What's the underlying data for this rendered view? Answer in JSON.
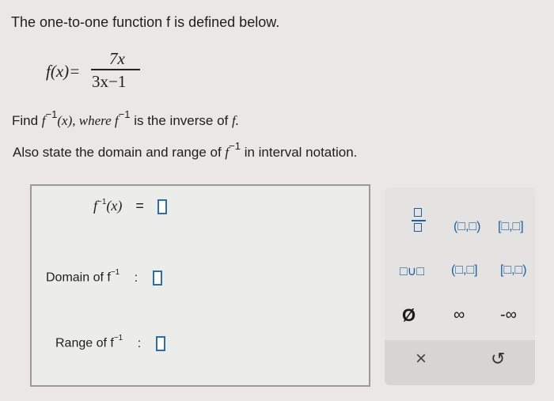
{
  "question": {
    "line1": "The one-to-one function f is defined below.",
    "func_lhs": "f(x)=",
    "numerator": "7x",
    "denominator": "3x−1",
    "find_prefix": "Find ",
    "find_f": "f",
    "exp": "−1",
    "find_mid": "(x), where ",
    "find_suffix": " is the inverse of ",
    "find_end": "f.",
    "also_prefix": "Also state the domain and range of ",
    "also_suffix": " in interval notation."
  },
  "answers": {
    "f_inv_label": "f",
    "f_inv_exp": "−1",
    "f_inv_arg": "(x)",
    "equals": "=",
    "domain_label": "Domain of f",
    "range_label": "Range of f",
    "colon": ":"
  },
  "palette": {
    "row1": [
      "(□,□)",
      "[□,□]"
    ],
    "union": "□∪□",
    "row2": [
      "(□,□]",
      "[□,□)"
    ],
    "empty": "Ø",
    "infinity": "∞",
    "neg_infinity": "-∞",
    "clear": "×",
    "undo": "↺"
  }
}
